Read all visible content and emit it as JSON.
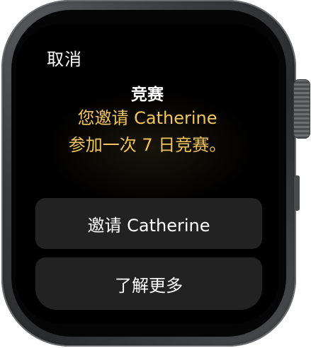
{
  "screen": {
    "cancel_label": "取消",
    "title": "竞赛",
    "message_line1": "您邀请 Catherine",
    "message_line2": "参加一次 7 日竞赛。",
    "invite_button_label": "邀请 Catherine",
    "learn_more_label": "了解更多"
  },
  "colors": {
    "message_text": "#f3c55a",
    "button_bg": "#222222",
    "screen_bg": "#000000"
  }
}
